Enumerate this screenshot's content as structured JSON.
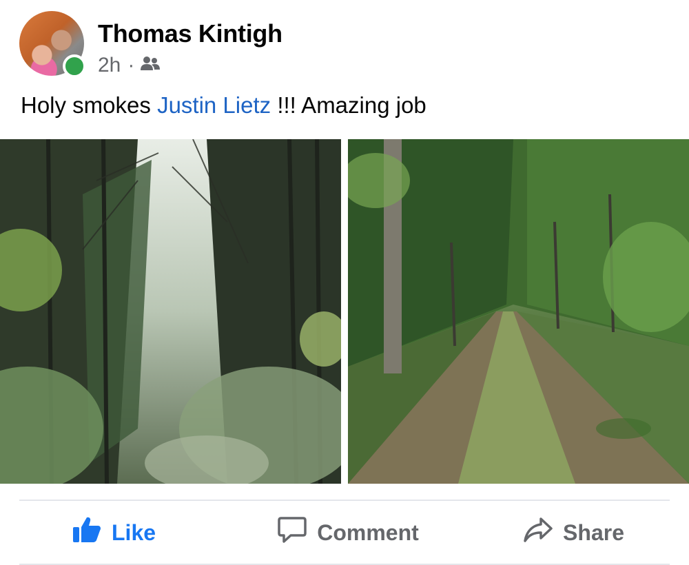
{
  "post": {
    "author": "Thomas Kintigh",
    "time": "2h",
    "separator": "·",
    "audience_icon": "friends-icon",
    "text_prefix": "Holy smokes",
    "mention": "Justin Lietz",
    "text_suffix": "!!! Amazing job"
  },
  "photos": [
    {
      "description_icon": "forest-canopy-photo"
    },
    {
      "description_icon": "forest-trail-photo"
    }
  ],
  "actions": {
    "like": "Like",
    "comment": "Comment",
    "share": "Share"
  },
  "colors": {
    "accent": "#1877f2",
    "mention": "#1d63c4",
    "online": "#31a24c",
    "secondary_text": "#65676b"
  }
}
